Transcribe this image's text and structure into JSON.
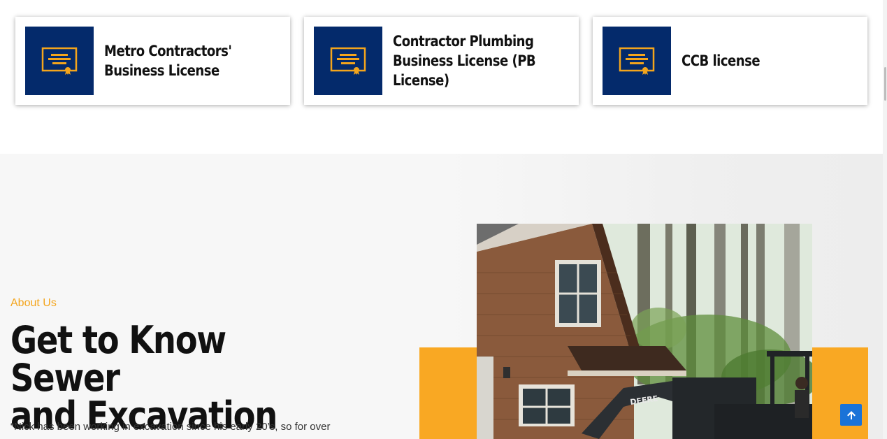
{
  "licenses": {
    "cards": [
      {
        "title": "Metro Contractors'\nBusiness License",
        "icon": "certificate-icon"
      },
      {
        "title": "Contractor Plumbing\nBusiness License (PB\nLicense)",
        "icon": "certificate-icon"
      },
      {
        "title": "CCB license",
        "icon": "certificate-icon"
      }
    ]
  },
  "about": {
    "eyebrow": "About Us",
    "heading": "Get to Know Sewer\nand Excavation",
    "paragraph": "“Nick has been working in excavation since his early 20’s, so for over",
    "photo_text": "DEERE"
  },
  "back_to_top": {
    "icon": "arrow-up-icon"
  },
  "colors": {
    "navy": "#042a6b",
    "gold": "#f4a51c",
    "orange": "#f9a823",
    "blue_button": "#1a73d8"
  }
}
